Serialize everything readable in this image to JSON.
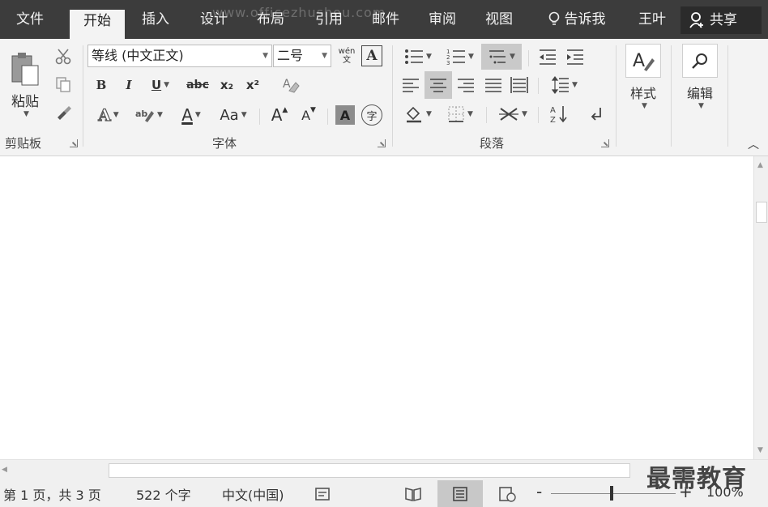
{
  "tabs": [
    "文件",
    "开始",
    "插入",
    "设计",
    "布局",
    "引用",
    "邮件",
    "审阅",
    "视图"
  ],
  "active_tab": "开始",
  "tell_me": "告诉我",
  "user_name": "王叶",
  "share_label": "共享",
  "watermark": "www.officezhushou.com",
  "clipboard": {
    "paste_label": "粘贴",
    "group_label": "剪贴板"
  },
  "font": {
    "font_name": "等线 (中文正文)",
    "font_size": "二号",
    "group_label": "字体",
    "bold": "B",
    "italic": "I",
    "underline": "U",
    "strike": "abc",
    "subscript": "x₂",
    "superscript": "x²",
    "change_case": "Aa",
    "grow": "A",
    "shrink": "A",
    "char_shading": "A",
    "enclose": "字",
    "font_color": "A",
    "text_effect": "A",
    "phonetic": "wén文",
    "char_border": "A"
  },
  "paragraph": {
    "group_label": "段落"
  },
  "styles": {
    "label": "样式"
  },
  "editing": {
    "label": "编辑"
  },
  "status": {
    "page": "第 1 页，共 3 页",
    "words": "522 个字",
    "language": "中文(中国)",
    "zoom": "100%"
  },
  "brand": "最需教育"
}
